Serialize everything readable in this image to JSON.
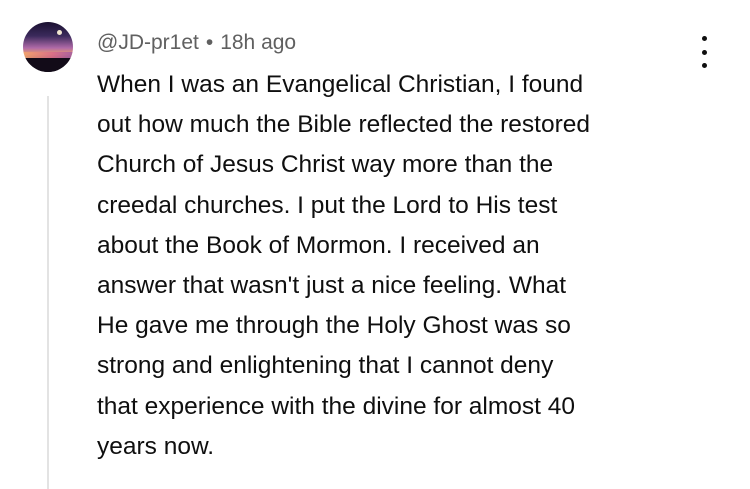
{
  "comment": {
    "author": "@JD-pr1et",
    "separator": "•",
    "timestamp": "18h ago",
    "text": "When I was an Evangelical Christian, I found\nout how much the Bible reflected the restored\nChurch of Jesus Christ way more than the\ncreedal churches.  I put the Lord to His test\nabout the Book of Mormon.  I received an\nanswer that wasn't just a nice feeling.  What\nHe gave me through the Holy Ghost was so\nstrong and enlightening that I cannot deny\nthat experience with the divine for almost 40\nyears now.",
    "avatar_icon": "avatar-sunset-image",
    "menu_icon": "more-vertical-icon"
  },
  "colors": {
    "text": "#0f0f0f",
    "meta": "#606060",
    "thread_line": "#e3e3e3",
    "background": "#ffffff"
  }
}
